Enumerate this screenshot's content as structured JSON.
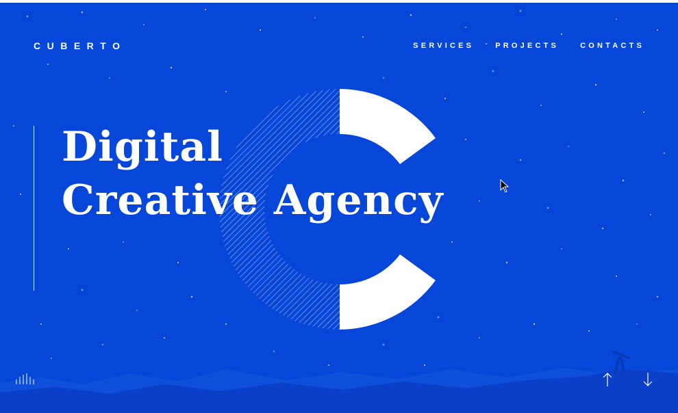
{
  "brand": {
    "logo_text": "CUBERTO"
  },
  "nav": {
    "items": [
      "SERVICES",
      "PROJECTS",
      "CONTACTS"
    ]
  },
  "hero": {
    "line1": "Digital",
    "line2": "Creative Agency"
  },
  "controls": {
    "sound_icon": "sound-bars-icon",
    "up_icon": "arrow-up-icon",
    "down_icon": "arrow-down-icon"
  },
  "colors": {
    "background": "#0646d8",
    "mountains": "#0a3fc7",
    "mountains_far": "#0d4fd9",
    "accent": "#ffffff"
  }
}
